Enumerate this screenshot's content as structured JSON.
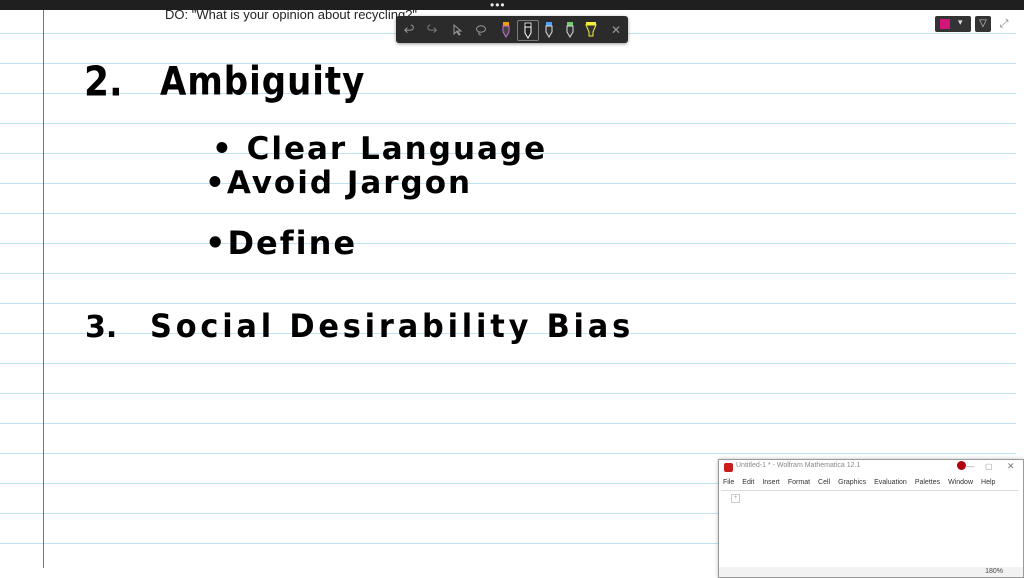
{
  "top_strip": {
    "menu_glyph": "•••"
  },
  "page": {
    "heading": "DO: \"What is your opinion about recycling?\"",
    "notes": {
      "item2_number": "2.",
      "item2_title": "Ambiguity",
      "bullet_1": "• Clear Language",
      "bullet_2": "•Avoid Jargon",
      "bullet_3": "•Define",
      "item3_number": "3.",
      "item3_title": "Social Desirability Bias"
    }
  },
  "ink_toolbar": {
    "undo_icon": "undo-icon",
    "redo_icon": "redo-icon",
    "select_icon": "select-icon",
    "lasso_icon": "lasso-icon",
    "pens": [
      {
        "name": "pen-orange-purple",
        "color": "#f0a000"
      },
      {
        "name": "pen-black",
        "color": "#ffffff"
      },
      {
        "name": "pen-blue",
        "color": "#4aa3ff"
      },
      {
        "name": "pen-green",
        "color": "#6fd06f"
      },
      {
        "name": "highlighter-yellow",
        "color": "#f4ef3a"
      }
    ],
    "close_glyph": "✕"
  },
  "top_right": {
    "active_color": "#d6157c"
  },
  "mathematica": {
    "title": "Untitled-1 * - Wolfram Mathematica 12.1",
    "menu": [
      "File",
      "Edit",
      "Insert",
      "Format",
      "Cell",
      "Graphics",
      "Evaluation",
      "Palettes",
      "Window",
      "Help"
    ],
    "zoom": "180%"
  }
}
